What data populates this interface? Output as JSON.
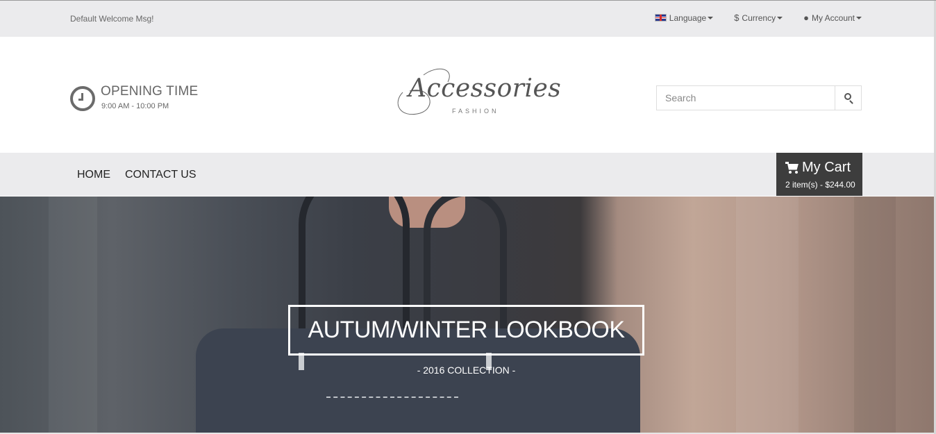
{
  "topbar": {
    "welcome": "Default Welcome Msg!",
    "language_label": "Language",
    "currency_label": "Currency",
    "currency_symbol": "$",
    "account_label": "My Account"
  },
  "header": {
    "opening_title": "OPENING TIME",
    "opening_hours": "9:00 AM - 10:00 PM",
    "logo_script": "Accessories",
    "logo_sub": "FASHION",
    "search_placeholder": "Search"
  },
  "nav": {
    "items": [
      {
        "label": "HOME"
      },
      {
        "label": "CONTACT US"
      }
    ]
  },
  "cart": {
    "title": "My Cart",
    "summary": "2 item(s) - $244.00"
  },
  "hero": {
    "title": "AUTUM/WINTER LOOKBOOK",
    "subtitle": "- 2016 COLLECTION -"
  },
  "colors": {
    "topbar_bg": "#ebebed",
    "cart_bg": "#3d3d3d",
    "text_gray": "#666666"
  }
}
